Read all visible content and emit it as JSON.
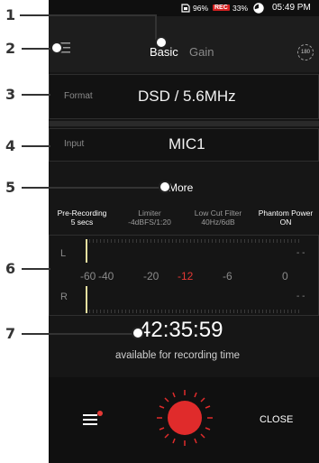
{
  "callouts": [
    "1",
    "2",
    "3",
    "4",
    "5",
    "6",
    "7"
  ],
  "status": {
    "battery": "96%",
    "rec_badge": "REC",
    "storage": "33%",
    "time": "05:49 PM"
  },
  "header": {
    "tab_basic": "Basic",
    "tab_gain": "Gain",
    "badge": "180"
  },
  "format": {
    "label": "Format",
    "value": "DSD / 5.6MHz"
  },
  "input": {
    "label": "Input",
    "value": "MIC1"
  },
  "more_label": "More",
  "settings": [
    {
      "label": "Pre-Recording",
      "value": "5 secs"
    },
    {
      "label": "Limiter",
      "value": "-4dBFS/1:20"
    },
    {
      "label": "Low Cut Filter",
      "value": "40Hz/6dB"
    },
    {
      "label": "Phantom Power",
      "value": "ON"
    }
  ],
  "meter": {
    "channel_l": "L",
    "channel_r": "R",
    "peak_l": "- -",
    "peak_r": "- -",
    "scale": [
      "-60",
      "-40",
      "-20",
      "-12",
      "-6",
      "0"
    ],
    "alert_color": "#e53935"
  },
  "recording": {
    "time_remaining": "42:35:59",
    "caption": "available for recording time"
  },
  "bottom": {
    "close_label": "CLOSE"
  },
  "colors": {
    "record": "#e02b2b",
    "menu_dot": "#e53935"
  }
}
